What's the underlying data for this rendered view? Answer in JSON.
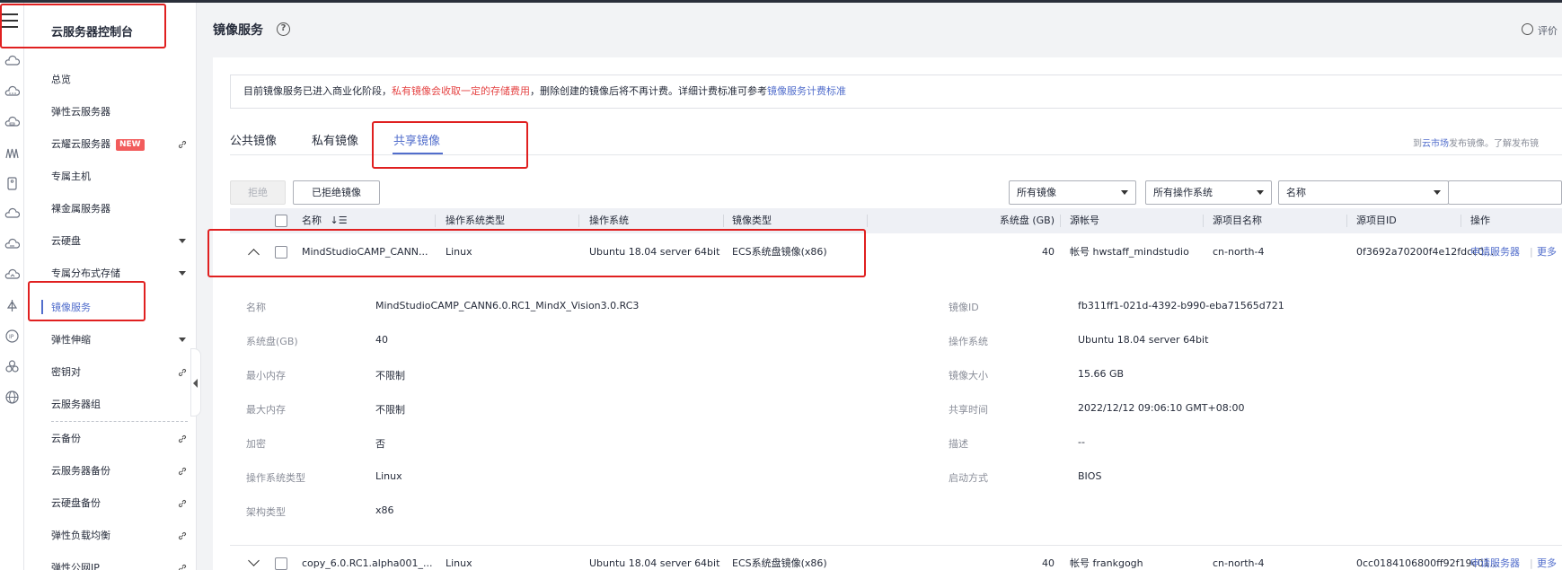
{
  "sidebar": {
    "title": "云服务器控制台",
    "items": [
      {
        "label": "总览"
      },
      {
        "label": "弹性云服务器"
      },
      {
        "label": "云耀云服务器",
        "badge": "NEW"
      },
      {
        "label": "专属主机"
      },
      {
        "label": "裸金属服务器"
      },
      {
        "label": "云硬盘"
      },
      {
        "label": "专属分布式存储"
      },
      {
        "label": "镜像服务"
      },
      {
        "label": "弹性伸缩"
      },
      {
        "label": "密钥对"
      },
      {
        "label": "云服务器组"
      },
      {
        "label": "云备份"
      },
      {
        "label": "云服务器备份"
      },
      {
        "label": "云硬盘备份"
      },
      {
        "label": "弹性负载均衡"
      },
      {
        "label": "弹性公网IP"
      }
    ]
  },
  "header": {
    "title": "镜像服务",
    "help": "?",
    "evaluate": "评价"
  },
  "notice": {
    "part1": "目前镜像服务已进入商业化阶段，",
    "part2": "私有镜像会收取一定的存储费用",
    "part3": "，删除创建的镜像后将不再计费。详细计费标准可参考",
    "link": "镜像服务计费标准"
  },
  "tabs": [
    "公共镜像",
    "私有镜像",
    "共享镜像"
  ],
  "right_hint": {
    "prefix": "到",
    "link": "云市场",
    "suffix": "发布镜像。了解发布镜"
  },
  "toolbar": {
    "reject": "拒绝",
    "rejected": "已拒绝镜像",
    "filter_all_images": "所有镜像",
    "filter_all_os": "所有操作系统",
    "filter_name": "名称"
  },
  "table": {
    "headers": [
      "名称",
      "操作系统类型",
      "操作系统",
      "镜像类型",
      "系统盘 (GB)",
      "源帐号",
      "源项目名称",
      "源项目ID",
      "操作"
    ],
    "sort_icon": "↓☰",
    "rows": [
      {
        "name": "MindStudioCAMP_CANN...",
        "os_type": "Linux",
        "os": "Ubuntu 18.04 server 64bit",
        "image_type": "ECS系统盘镜像(x86)",
        "disk": "40",
        "account": "帐号 hwstaff_mindstudio",
        "project": "cn-north-4",
        "project_id": "0f3692a70200f4e12fdcc01b0...",
        "action1": "申请服务器",
        "action2": "更多"
      },
      {
        "name": "copy_6.0.RC1.alpha001_...",
        "os_type": "Linux",
        "os": "Ubuntu 18.04 server 64bit",
        "image_type": "ECS系统盘镜像(x86)",
        "disk": "40",
        "account": "帐号 frankgogh",
        "project": "cn-north-4",
        "project_id": "0cc0184106800ff92f19c01f5e...",
        "action1": "申请服务器",
        "action2": "更多"
      }
    ]
  },
  "detail": {
    "left": [
      {
        "label": "名称",
        "value": "MindStudioCAMP_CANN6.0.RC1_MindX_Vision3.0.RC3"
      },
      {
        "label": "系统盘(GB)",
        "value": "40"
      },
      {
        "label": "最小内存",
        "value": "不限制"
      },
      {
        "label": "最大内存",
        "value": "不限制"
      },
      {
        "label": "加密",
        "value": "否"
      },
      {
        "label": "操作系统类型",
        "value": "Linux"
      },
      {
        "label": "架构类型",
        "value": "x86"
      }
    ],
    "right": [
      {
        "label": "镜像ID",
        "value": "fb311ff1-021d-4392-b990-eba71565d721"
      },
      {
        "label": "操作系统",
        "value": "Ubuntu 18.04 server 64bit"
      },
      {
        "label": "镜像大小",
        "value": "15.66 GB"
      },
      {
        "label": "共享时间",
        "value": "2022/12/12 09:06:10 GMT+08:00"
      },
      {
        "label": "描述",
        "value": "--"
      },
      {
        "label": "启动方式",
        "value": "BIOS"
      }
    ]
  },
  "colors": {
    "accent": "#526ecc",
    "highlight": "#e02020",
    "warning_text": "#e54545"
  }
}
